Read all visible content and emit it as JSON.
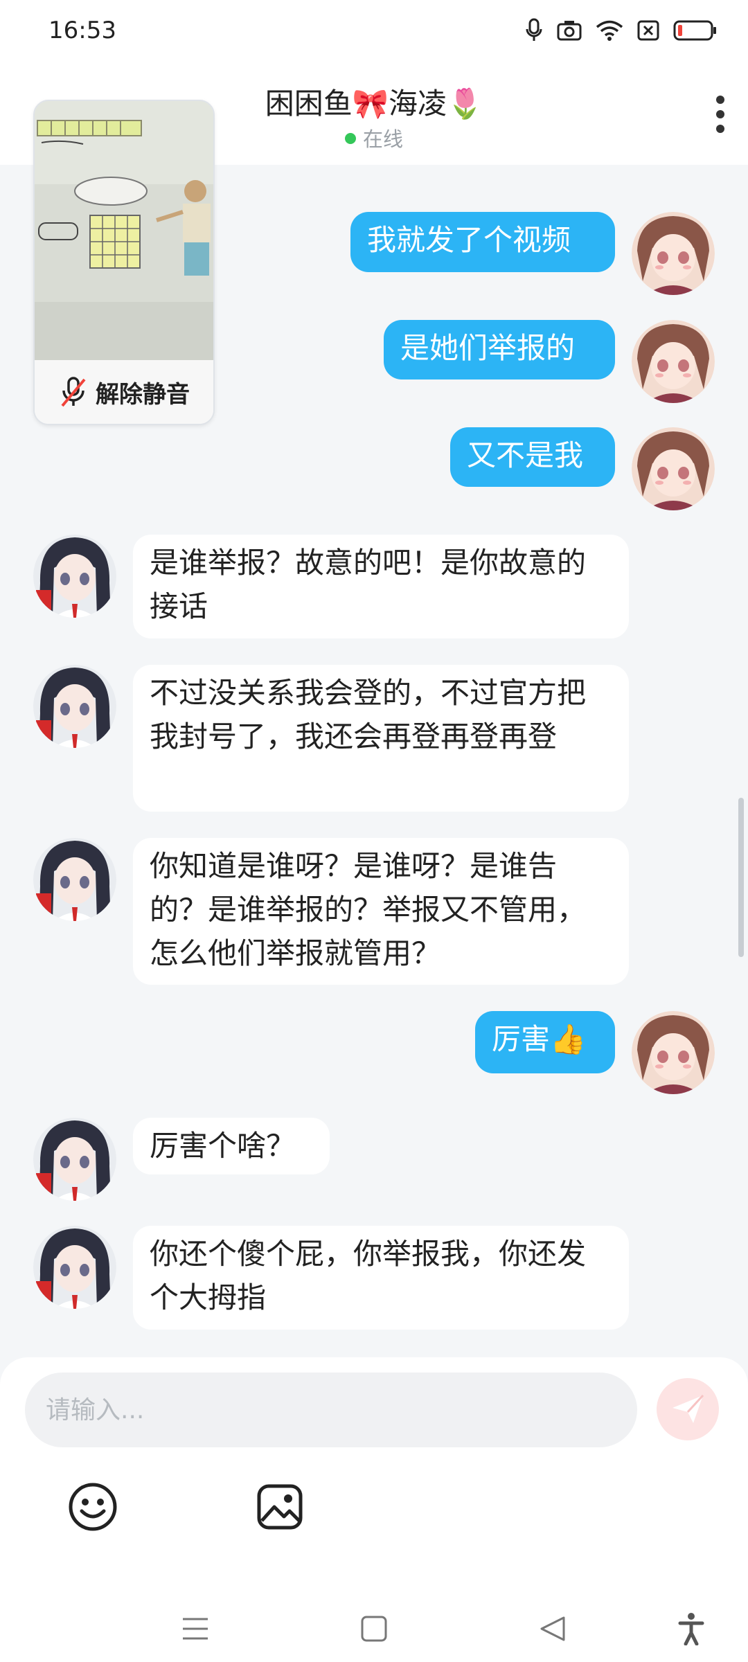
{
  "status_bar": {
    "time": "16:53"
  },
  "header": {
    "title": "困困鱼🎀海凌🌷",
    "presence": "在线"
  },
  "pip": {
    "unmute_label": "解除静音"
  },
  "messages": [
    {
      "side": "out",
      "text": "我就发了个视频"
    },
    {
      "side": "out",
      "text": "是她们举报的"
    },
    {
      "side": "out",
      "text": "又不是我"
    },
    {
      "side": "in",
      "text": "是谁举报？故意的吧！是你故意的接话"
    },
    {
      "side": "in",
      "text": "不过没关系我会登的，不过官方把我封号了，我还会再登再登再登"
    },
    {
      "side": "in",
      "text": "你知道是谁呀？是谁呀？是谁告的？是谁举报的？举报又不管用，怎么他们举报就管用？"
    },
    {
      "side": "out",
      "text": "厉害👍"
    },
    {
      "side": "in",
      "text": "厉害个啥？"
    },
    {
      "side": "in",
      "text": "你还个傻个屁，你举报我，你还发个大拇指"
    }
  ],
  "composer": {
    "placeholder": "请输入..."
  },
  "icons": {
    "mic": "microphone-icon",
    "camera": "camera-icon",
    "wifi": "wifi-icon",
    "sim": "sim-off-icon",
    "battery": "battery-low-icon",
    "more": "more-vertical-icon",
    "mute": "mic-off-icon",
    "send": "send-icon",
    "emoji": "emoji-icon",
    "image": "image-icon",
    "menu": "menu-icon",
    "home": "home-square-icon",
    "back": "back-triangle-icon",
    "accessibility": "accessibility-icon"
  },
  "colors": {
    "outgoing_bubble": "#2cb4f5",
    "incoming_bubble": "#ffffff",
    "background": "#f4f6f8",
    "online": "#34c759"
  }
}
